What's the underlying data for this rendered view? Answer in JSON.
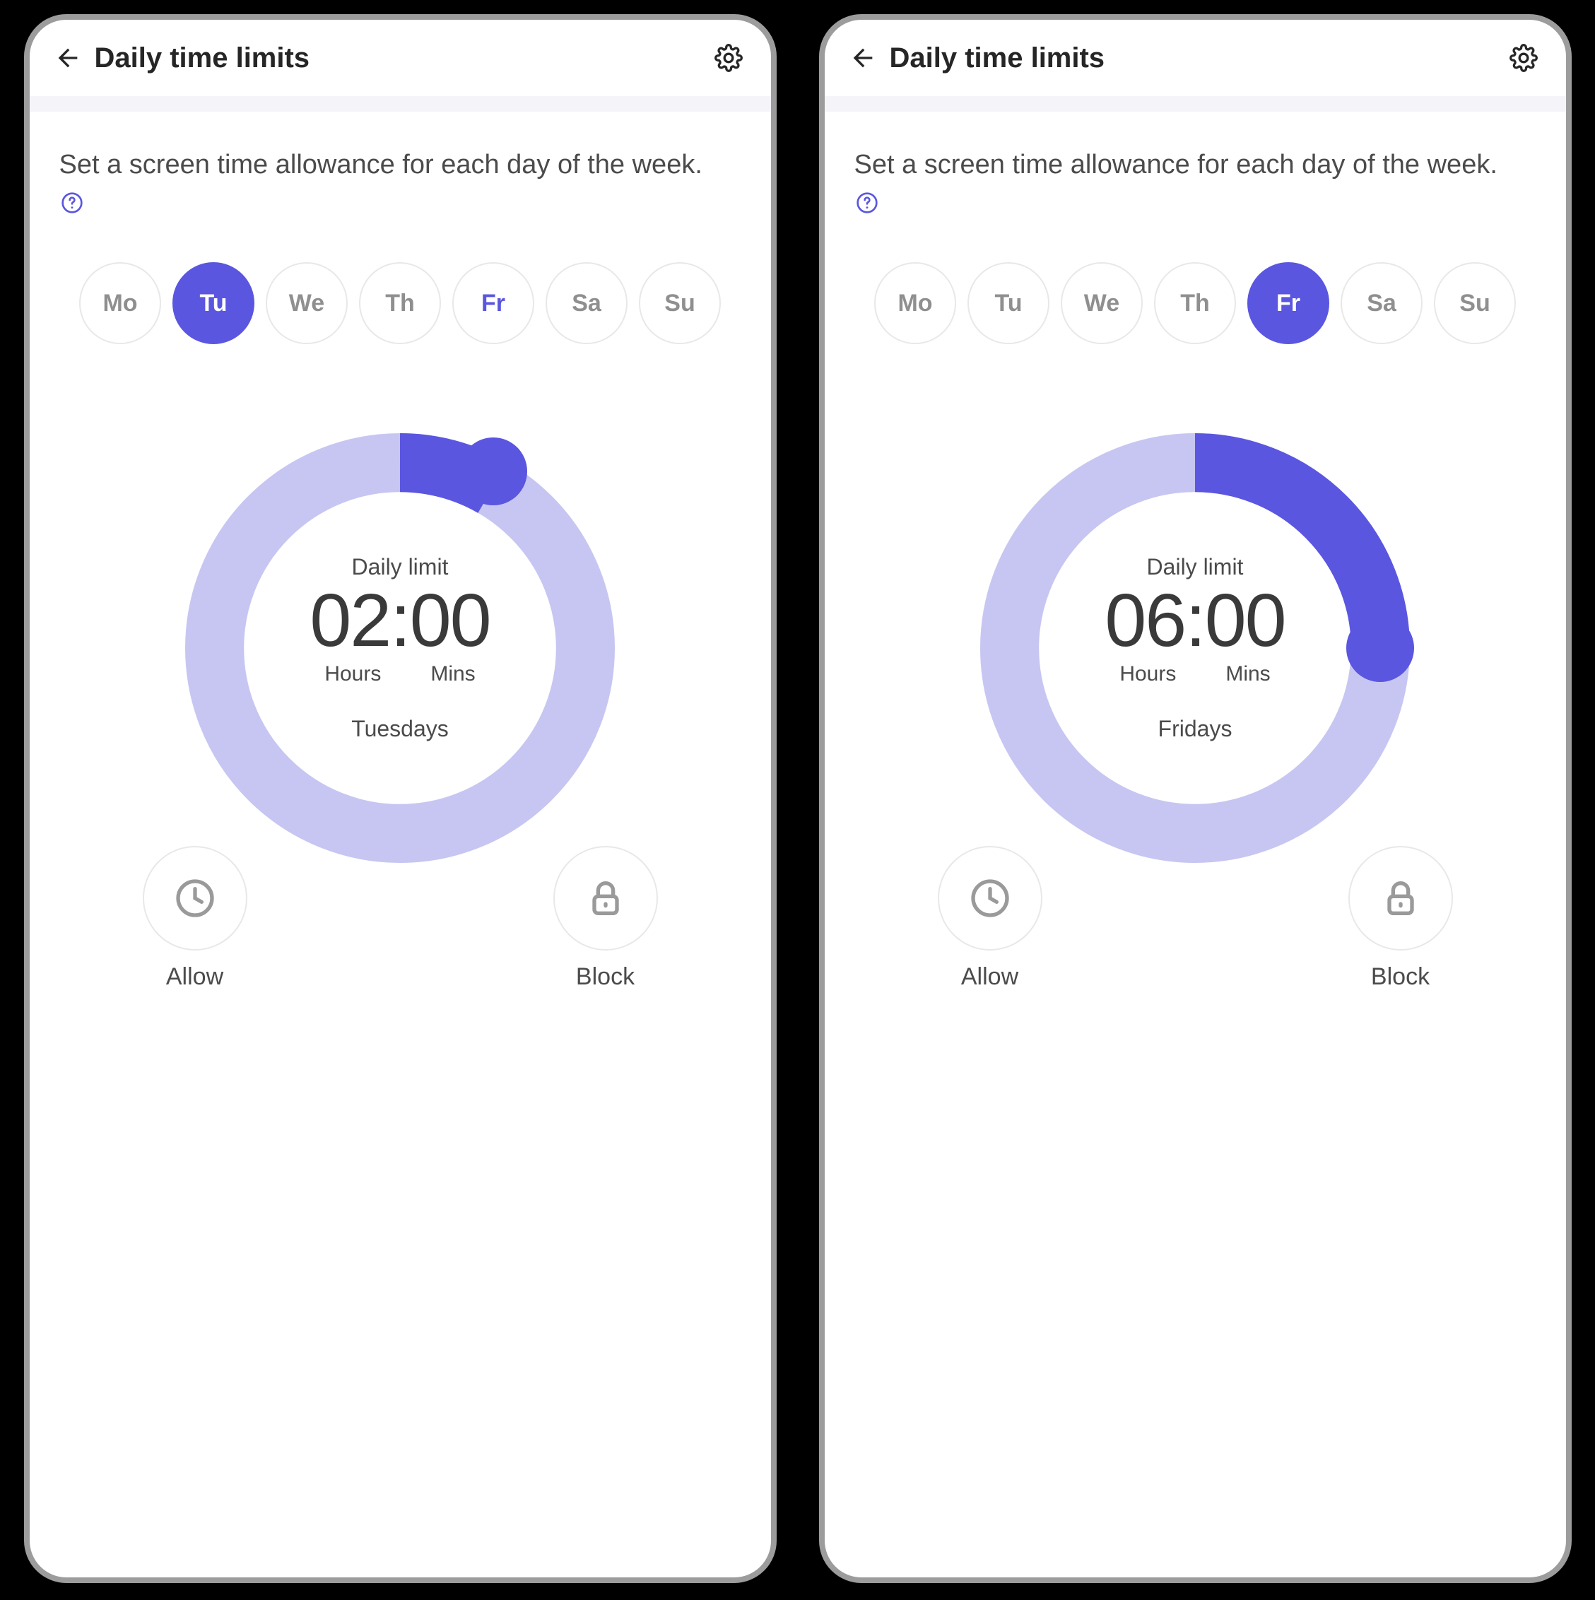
{
  "colors": {
    "accent": "#5a56e0",
    "accent_light": "#c7c6f2"
  },
  "header": {
    "title": "Daily time limits"
  },
  "intro": {
    "text": "Set a screen time allowance for each day of the week."
  },
  "days": [
    {
      "abbr": "Mo"
    },
    {
      "abbr": "Tu"
    },
    {
      "abbr": "We"
    },
    {
      "abbr": "Th"
    },
    {
      "abbr": "Fr"
    },
    {
      "abbr": "Sa"
    },
    {
      "abbr": "Su"
    }
  ],
  "dial": {
    "daily_limit_label": "Daily limit",
    "hours_label": "Hours",
    "mins_label": "Mins"
  },
  "actions": {
    "allow": "Allow",
    "block": "Block"
  },
  "screens": [
    {
      "selected_day_index": 1,
      "highlight_day_index": 4,
      "time_display": "02:00",
      "hours": 2,
      "day_name": "Tuesdays"
    },
    {
      "selected_day_index": 4,
      "highlight_day_index": null,
      "time_display": "06:00",
      "hours": 6,
      "day_name": "Fridays"
    }
  ]
}
